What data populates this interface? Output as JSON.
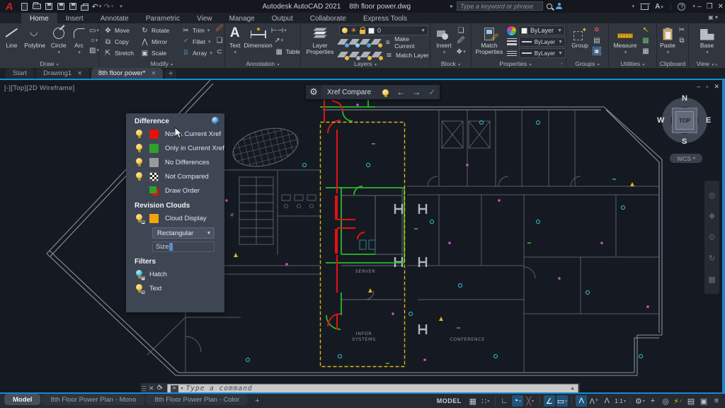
{
  "titlebar": {
    "app": "Autodesk AutoCAD 2021",
    "doc": "8th floor power.dwg",
    "search_placeholder": "Type a keyword or phrase"
  },
  "ribbon": {
    "tabs": [
      "Home",
      "Insert",
      "Annotate",
      "Parametric",
      "View",
      "Manage",
      "Output",
      "Collaborate",
      "Express Tools"
    ],
    "active_tab": "Home",
    "draw": {
      "label": "Draw",
      "line": "Line",
      "polyline": "Polyline",
      "circle": "Circle",
      "arc": "Arc"
    },
    "modify": {
      "label": "Modify",
      "move": "Move",
      "rotate": "Rotate",
      "trim": "Trim",
      "copy": "Copy",
      "mirror": "Mirror",
      "fillet": "Fillet",
      "stretch": "Stretch",
      "scale": "Scale",
      "array": "Array"
    },
    "annotation": {
      "label": "Annotation",
      "text": "Text",
      "dimension": "Dimension",
      "table": "Table"
    },
    "layers": {
      "label": "Layers",
      "layer_properties": "Layer Properties",
      "current_layer": "0",
      "make_current": "Make Current",
      "match_layer": "Match Layer"
    },
    "block": {
      "label": "Block",
      "insert": "Insert"
    },
    "properties": {
      "label": "Properties",
      "match_properties": "Match Properties",
      "bylayer": "ByLayer"
    },
    "groups": {
      "label": "Groups",
      "group": "Group"
    },
    "utilities": {
      "label": "Utilities",
      "measure": "Measure"
    },
    "clipboard": {
      "label": "Clipboard",
      "paste": "Paste"
    },
    "view": {
      "label": "View",
      "base": "Base"
    }
  },
  "file_tabs": {
    "tabs": [
      {
        "label": "Start",
        "closable": false,
        "active": false
      },
      {
        "label": "Drawing1",
        "closable": true,
        "active": false
      },
      {
        "label": "8th floor power*",
        "closable": true,
        "active": true
      }
    ]
  },
  "viewport": {
    "corner_label": "[-][Top][2D Wireframe]",
    "compass": {
      "n": "N",
      "s": "S",
      "e": "E",
      "w": "W",
      "cube": "TOP",
      "wcs": "WCS"
    },
    "plan_texts": {
      "server": "SERVER",
      "infor1": "INFOR",
      "infor2": "SYSTEMS",
      "conference": "CONFERENCE",
      "stair": "N"
    }
  },
  "xref_toolbar": {
    "title": "Xref Compare"
  },
  "compare_panel": {
    "difference": {
      "header": "Difference",
      "rows": [
        {
          "label": "Not in Current Xref",
          "color": "#e8100a"
        },
        {
          "label": "Only in Current Xref",
          "color": "#2fa12b"
        },
        {
          "label": "No Differences",
          "color": "#9a9a9a"
        },
        {
          "label": "Not Compared",
          "color": "checker"
        },
        {
          "label": "Draw Order",
          "color": "#2fa12b"
        }
      ]
    },
    "revision_clouds": {
      "header": "Revision Clouds",
      "cloud_display": "Cloud Display",
      "cloud_color": "#f0a50a",
      "shape": "Rectangular",
      "size_value": "Size"
    },
    "filters": {
      "header": "Filters",
      "hatch": "Hatch",
      "text": "Text"
    }
  },
  "command_line": {
    "placeholder": "Type a command"
  },
  "status_bar": {
    "layout_tabs": [
      "Model",
      "8th Floor Power Plan - Mono",
      "8th Floor Power Plan - Color"
    ],
    "active_layout": "Model",
    "model_badge": "MODEL",
    "scale": "1:1"
  },
  "colors": {
    "accent_blue": "#0a96d7",
    "compare_red": "#e8100a",
    "compare_green": "#2fa12b",
    "cloud_yellow": "#d9b616",
    "canvas_bg": "#151a22"
  }
}
